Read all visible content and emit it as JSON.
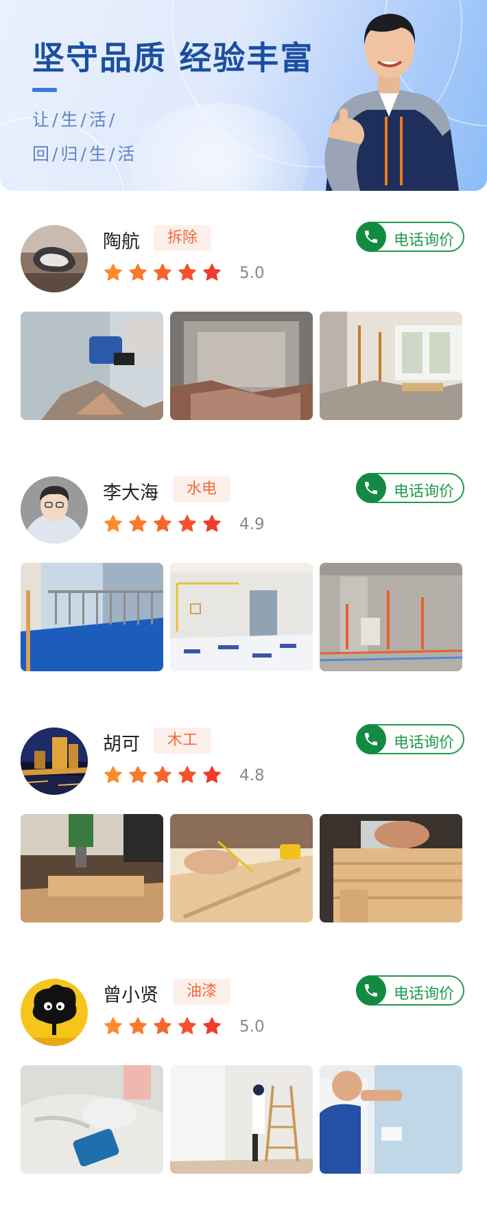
{
  "banner": {
    "title": "坚守品质 经验丰富",
    "subtitle_line1": "让/生/活/",
    "subtitle_line2": "回/归/生/活"
  },
  "call_label": "电话询价",
  "workers": [
    {
      "name": "陶航",
      "tag": "拆除",
      "rating": 5.0,
      "score": "5.0"
    },
    {
      "name": "李大海",
      "tag": "水电",
      "rating": 4.9,
      "score": "4.9"
    },
    {
      "name": "胡可",
      "tag": "木工",
      "rating": 4.8,
      "score": "4.8"
    },
    {
      "name": "曾小贤",
      "tag": "油漆",
      "rating": 5.0,
      "score": "5.0"
    }
  ],
  "colors": {
    "brand_blue": "#1a4fa0",
    "call_green": "#1f9a4e",
    "tag_text": "#ee6b3b",
    "tag_bg": "#fdefe9",
    "star_start": "#ff8a2b",
    "star_end": "#f03a2b"
  },
  "icons": [
    "phone-icon",
    "star-icon"
  ]
}
